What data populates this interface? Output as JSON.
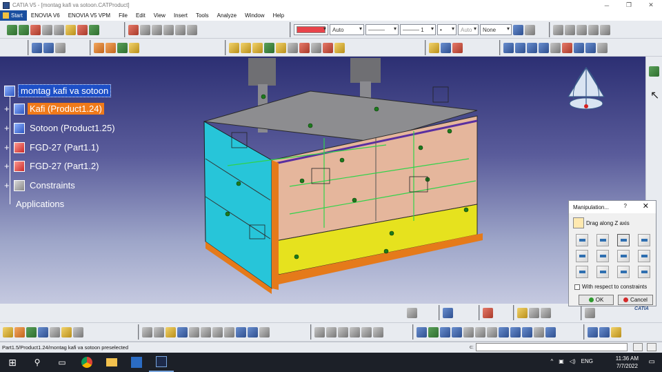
{
  "window": {
    "title": "CATIA V5 - [montag kafi va sotoon.CATProduct]"
  },
  "menu": [
    "Start",
    "ENOVIA V6",
    "ENOVIA V5 VPM",
    "File",
    "Edit",
    "View",
    "Insert",
    "Tools",
    "Analyze",
    "Window",
    "Help"
  ],
  "graphic_props": {
    "color": "#e8434a",
    "transparency": "Auto",
    "linetype": "———",
    "thickness": "——— 1",
    "point": "•",
    "layer_auto": "Auto",
    "layer": "None"
  },
  "tree": {
    "root": "montag kafi va sotoon",
    "items": [
      {
        "label": "Kafi (Product1.24)",
        "type": "product",
        "highlight": true
      },
      {
        "label": "Sotoon (Product1.25)",
        "type": "product",
        "highlight": false
      },
      {
        "label": "FGD-27 (Part1.1)",
        "type": "part",
        "highlight": false
      },
      {
        "label": "FGD-27 (Part1.2)",
        "type": "part",
        "highlight": false
      },
      {
        "label": "Constraints",
        "type": "constraints",
        "highlight": false
      }
    ],
    "applications": "Applications"
  },
  "dialog": {
    "title": "Manipulation...",
    "help": "?",
    "close": "✕",
    "mode": "Drag along Z axis",
    "checkbox": "With respect to constraints",
    "ok": "OK",
    "cancel": "Cancel"
  },
  "status": {
    "text": "Part1.5/Product1.24/montag kafi va sotoon preselected",
    "cmd_label": "c:"
  },
  "taskbar": {
    "lang": "ENG",
    "time": "11:36 AM",
    "date": "7/7/2022"
  },
  "colors": {
    "viewport_top": "#2c2f73",
    "viewport_bottom": "#c5c9e0",
    "highlight": "#f07a1a",
    "selection": "#1d4fc7"
  }
}
